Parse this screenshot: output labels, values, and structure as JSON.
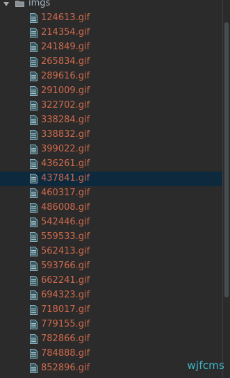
{
  "tree": {
    "folder": {
      "label": "imgs",
      "expanded": true,
      "icon": "folder-icon"
    },
    "files": [
      {
        "name": "124613.gif"
      },
      {
        "name": "214354.gif"
      },
      {
        "name": "241849.gif"
      },
      {
        "name": "265834.gif"
      },
      {
        "name": "289616.gif"
      },
      {
        "name": "291009.gif"
      },
      {
        "name": "322702.gif"
      },
      {
        "name": "338284.gif"
      },
      {
        "name": "338832.gif"
      },
      {
        "name": "399022.gif"
      },
      {
        "name": "436261.gif"
      },
      {
        "name": "437841.gif",
        "selected": true
      },
      {
        "name": "460317.gif"
      },
      {
        "name": "486008.gif"
      },
      {
        "name": "542446.gif"
      },
      {
        "name": "559533.gif"
      },
      {
        "name": "562413.gif"
      },
      {
        "name": "593766.gif"
      },
      {
        "name": "662241.gif"
      },
      {
        "name": "694323.gif"
      },
      {
        "name": "718017.gif"
      },
      {
        "name": "779155.gif"
      },
      {
        "name": "782866.gif"
      },
      {
        "name": "784888.gif"
      },
      {
        "name": "852896.gif"
      }
    ]
  },
  "watermark": "wjfcms",
  "colors": {
    "background": "#2b2b2b",
    "file_text": "#cf6a4c",
    "selection": "#0d293e",
    "watermark": "#3fb8c8"
  }
}
